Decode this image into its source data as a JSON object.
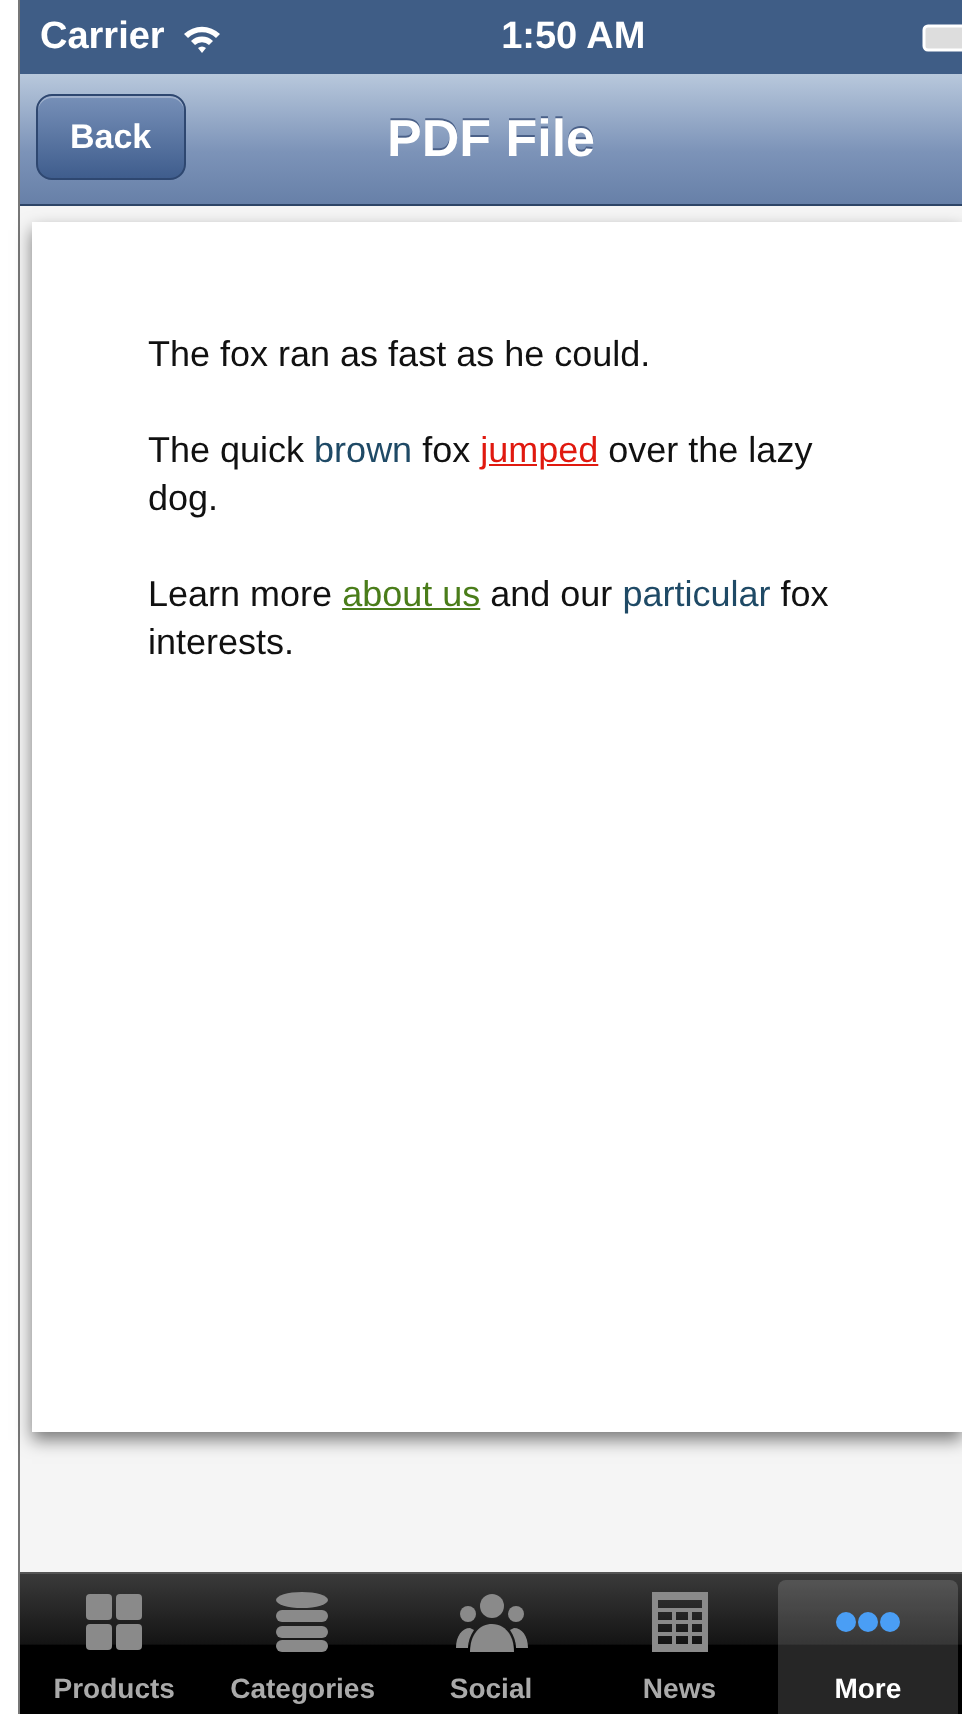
{
  "status_bar": {
    "carrier": "Carrier",
    "time": "1:50 AM"
  },
  "nav_bar": {
    "back": "Back",
    "title": "PDF File"
  },
  "document": {
    "paragraphs": [
      [
        {
          "kind": "text",
          "text": "The fox ran as fast as he could."
        }
      ],
      [
        {
          "kind": "text",
          "text": "The quick "
        },
        {
          "kind": "text",
          "text": "brown",
          "color": "#1f4a66"
        },
        {
          "kind": "text",
          "text": " fox "
        },
        {
          "kind": "link",
          "text": "jumped",
          "color": "#e0190f"
        },
        {
          "kind": "text",
          "text": " over the lazy dog."
        }
      ],
      [
        {
          "kind": "text",
          "text": "Learn more "
        },
        {
          "kind": "link",
          "text": "about us",
          "color": "#4a7d1a"
        },
        {
          "kind": "text",
          "text": " and our "
        },
        {
          "kind": "text",
          "text": "particular",
          "color": "#1f4a66"
        },
        {
          "kind": "text",
          "text": " fox interests."
        }
      ]
    ]
  },
  "tab_bar": [
    {
      "label": "Products",
      "selected": false
    },
    {
      "label": "Categories",
      "selected": false
    },
    {
      "label": "Social",
      "selected": false
    },
    {
      "label": "News",
      "selected": false
    },
    {
      "label": "More",
      "selected": true
    }
  ]
}
